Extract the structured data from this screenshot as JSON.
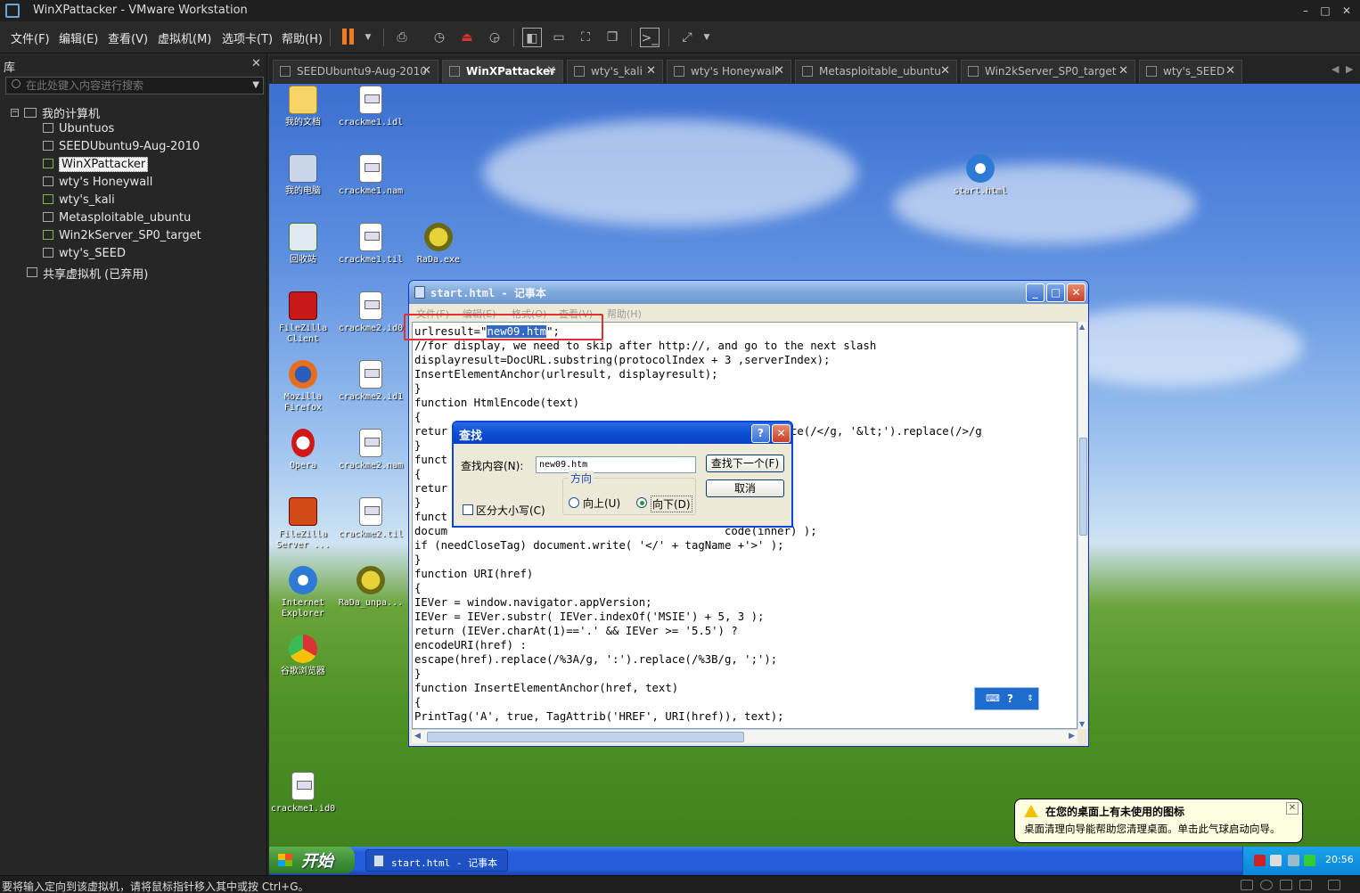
{
  "window": {
    "title": "WinXPattacker - VMware Workstation"
  },
  "menubar": {
    "items": [
      "文件(F)",
      "编辑(E)",
      "查看(V)",
      "虚拟机(M)",
      "选项卡(T)",
      "帮助(H)"
    ]
  },
  "library": {
    "header": "库",
    "search_placeholder": "在此处键入内容进行搜索",
    "root_label": "我的计算机",
    "vms": [
      "Ubuntuos",
      "SEEDUbuntu9-Aug-2010",
      "WinXPattacker",
      "wty's Honeywall",
      "wty's_kali",
      "Metasploitable_ubuntu",
      "Win2kServer_SP0_target",
      "wty's_SEED"
    ],
    "shared_label": "共享虚拟机 (已弃用)",
    "selected": "WinXPattacker"
  },
  "tabs": [
    "SEEDUbuntu9-Aug-2010",
    "WinXPattacker",
    "wty's_kali",
    "wty's Honeywall",
    "Metasploitable_ubuntu",
    "Win2kServer_SP0_target",
    "wty's_SEED"
  ],
  "desktop": {
    "icons_col1": [
      "我的文档",
      "我的电脑",
      "回收站",
      "FileZilla Client",
      "Mozilla Firefox",
      "Opera",
      "FileZilla Server ...",
      "Internet Explorer",
      "谷歌浏览器"
    ],
    "icons_col2": [
      "crackme1.idl",
      "crackme1.nam",
      "crackme1.til",
      "crackme2.id0",
      "crackme2.id1",
      "crackme2.nam",
      "crackme2.til",
      "RaDa_unpa..."
    ],
    "rada": "RaDa.exe",
    "start_html": "start.html",
    "crackme1_id0": "crackme1.id0"
  },
  "notepad": {
    "title": "start.html - 记事本",
    "menu": [
      "文件(F)",
      "编辑(E)",
      "格式(O)",
      "查看(V)",
      "帮助(H)"
    ],
    "line0_prefix": "urlresult=\"",
    "line0_selected": "new09.htm",
    "line0_suffix": "\";",
    "lines": [
      "//for display, we need to skip after http://, and go to the next slash",
      "displayresult=DocURL.substring(protocolIndex + 3 ,serverIndex);",
      "InsertElementAnchor(urlresult, displayresult);",
      "}",
      "function HtmlEncode(text)",
      "{",
      "retur                                           ;').replace(/</g, '&lt;').replace(/>/g",
      "}",
      "funct",
      "{",
      "retur",
      "}",
      "funct                                          ){",
      "docum                                          code(inner) );",
      "if (needCloseTag) document.write( '</' + tagName +'>' );",
      "}",
      "function URI(href)",
      "{",
      "IEVer = window.navigator.appVersion;",
      "IEVer = IEVer.substr( IEVer.indexOf('MSIE') + 5, 3 );",
      "return (IEVer.charAt(1)=='.' && IEVer >= '5.5') ?",
      "encodeURI(href) :",
      "escape(href).replace(/%3A/g, ':').replace(/%3B/g, ';');",
      "}",
      "function InsertElementAnchor(href, text)",
      "{",
      "PrintTag('A', true, TagAttrib('HREF', URI(href)), text);"
    ]
  },
  "find_dialog": {
    "title": "查找",
    "find_label": "查找内容(N):",
    "find_value": "new09.htm",
    "find_next": "查找下一个(F)",
    "cancel": "取消",
    "direction": "方向",
    "up": "向上(U)",
    "down": "向下(D)",
    "match_case": "区分大小写(C)"
  },
  "balloon": {
    "title": "在您的桌面上有未使用的图标",
    "body": "桌面清理向导能帮助您清理桌面。单击此气球启动向导。"
  },
  "taskbar": {
    "start": "开始",
    "task": "start.html - 记事本",
    "clock": "20:56"
  },
  "status": {
    "message": "要将输入定向到该虚拟机，请将鼠标指针移入其中或按 Ctrl+G。"
  },
  "colors": {
    "accent_orange": "#f07a1c",
    "xp_blue": "#245edb",
    "highlight": "#316ac5",
    "annotation_red": "#e03030"
  }
}
